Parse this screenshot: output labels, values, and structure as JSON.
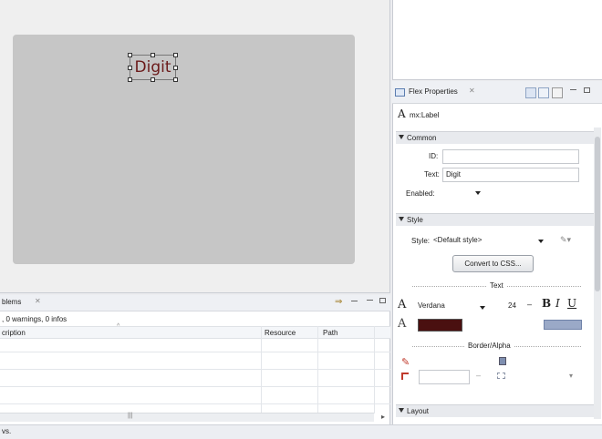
{
  "design": {
    "label_text": "Digit"
  },
  "problems": {
    "tab_label": "blems",
    "summary": ", 0 warnings, 0 infos",
    "columns": [
      "cription",
      "Resource",
      "Path"
    ]
  },
  "properties": {
    "tab_label": "Flex Properties",
    "component_type": "mx:Label",
    "sections": {
      "common": "Common",
      "style": "Style",
      "layout": "Layout"
    },
    "common": {
      "id_label": "ID:",
      "id_value": "",
      "text_label": "Text:",
      "text_value": "Digit",
      "enabled_label": "Enabled:",
      "enabled_value": ""
    },
    "style": {
      "style_label": "Style:",
      "style_value": "<Default style>",
      "convert_button": "Convert to CSS..."
    },
    "text_group": {
      "header": "Text",
      "font_family": "Verdana",
      "font_size": "24",
      "bold": "B",
      "italic": "I",
      "underline": "U",
      "font_color": "#4a1010"
    },
    "border_alpha": {
      "header": "Border/Alpha"
    }
  },
  "status": {
    "text": "vs."
  },
  "colors": {
    "canvas": "#c6c6c6",
    "label_text": "#6b1a1a",
    "swatch": "#4a1010"
  }
}
